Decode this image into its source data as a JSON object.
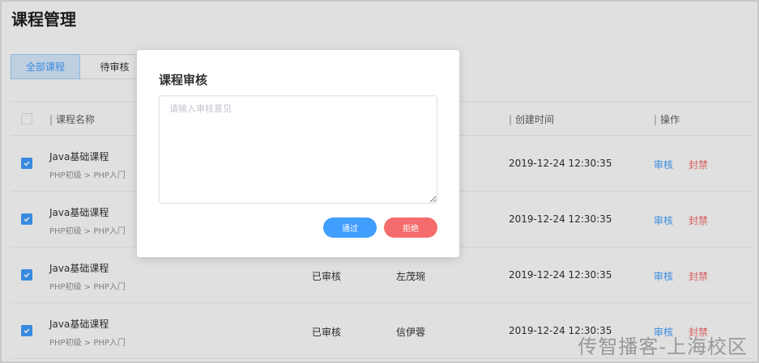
{
  "page": {
    "title": "课程管理"
  },
  "tabs": [
    {
      "label": "全部课程",
      "active": true
    },
    {
      "label": "待审核",
      "active": false
    }
  ],
  "table": {
    "headers": {
      "name": "课程名称",
      "time": "创建时间",
      "actions": "操作",
      "separator": "|"
    },
    "rows": [
      {
        "checked": true,
        "name": "Java基础课程",
        "category": "PHP初级 > PHP入门",
        "status": "",
        "author": "",
        "time": "2019-12-24 12:30:35",
        "audit": "审核",
        "ban": "封禁"
      },
      {
        "checked": true,
        "name": "Java基础课程",
        "category": "PHP初级 > PHP入门",
        "status": "",
        "author": "",
        "time": "2019-12-24 12:30:35",
        "audit": "审核",
        "ban": "封禁"
      },
      {
        "checked": true,
        "name": "Java基础课程",
        "category": "PHP初级 > PHP入门",
        "status": "已审核",
        "author": "左茂琬",
        "time": "2019-12-24 12:30:35",
        "audit": "审核",
        "ban": "封禁"
      },
      {
        "checked": true,
        "name": "Java基础课程",
        "category": "PHP初级 > PHP入门",
        "status": "已审核",
        "author": "信伊蓉",
        "time": "2019-12-24 12:30:35",
        "audit": "审核",
        "ban": "封禁"
      }
    ]
  },
  "dialog": {
    "title": "课程审核",
    "textarea_placeholder": "请输入审核意见",
    "pass_label": "通过",
    "reject_label": "拒绝"
  },
  "watermark": "传智播客-上海校区",
  "colors": {
    "primary": "#409eff",
    "danger": "#f56c6c"
  }
}
